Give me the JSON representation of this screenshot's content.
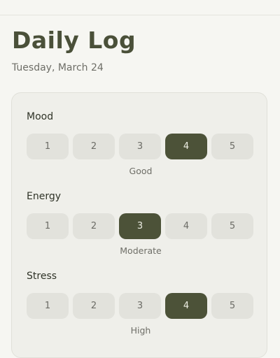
{
  "header": {
    "title": "Daily Log",
    "date": "Tuesday, March 24"
  },
  "log": {
    "sections": [
      {
        "label": "Mood",
        "options": [
          "1",
          "2",
          "3",
          "4",
          "5"
        ],
        "selected_value": 4,
        "caption": "Good"
      },
      {
        "label": "Energy",
        "options": [
          "1",
          "2",
          "3",
          "4",
          "5"
        ],
        "selected_value": 3,
        "caption": "Moderate"
      },
      {
        "label": "Stress",
        "options": [
          "1",
          "2",
          "3",
          "4",
          "5"
        ],
        "selected_value": 4,
        "caption": "High"
      }
    ]
  },
  "colors": {
    "accent": "#4c5238",
    "background": "#f6f6f2",
    "card": "#efefea",
    "option": "#e2e2dc"
  }
}
